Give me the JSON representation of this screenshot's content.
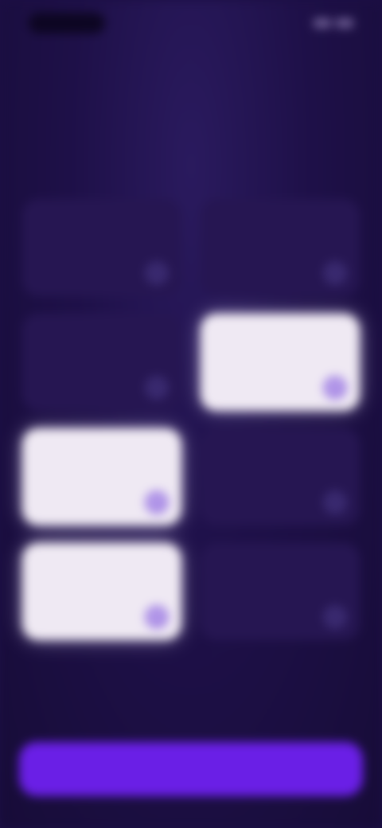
{
  "colors": {
    "background": "#1c0f45",
    "card": "#261652",
    "card_selected": "#efe9f3",
    "accent": "#6a1fe6",
    "check_selected": "#a98be6"
  },
  "header": {
    "title": "",
    "subtitle": ""
  },
  "options": [
    {
      "label": "",
      "sub": "",
      "selected": false
    },
    {
      "label": "",
      "sub": "",
      "selected": false
    },
    {
      "label": "",
      "sub": "",
      "selected": false
    },
    {
      "label": "",
      "sub": "",
      "selected": true
    },
    {
      "label": "",
      "sub": "",
      "selected": true
    },
    {
      "label": "",
      "sub": "",
      "selected": false
    },
    {
      "label": "",
      "sub": "",
      "selected": true
    },
    {
      "label": "",
      "sub": "",
      "selected": false
    }
  ],
  "check_icon": "✓",
  "footer": {
    "continue_label": ""
  }
}
